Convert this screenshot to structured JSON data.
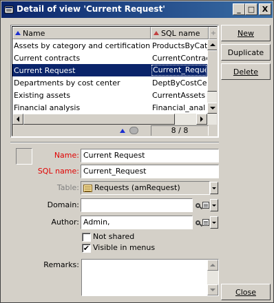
{
  "window": {
    "title": "Detail of view 'Current Request'"
  },
  "titlebar_buttons": {
    "minimize": "_",
    "maximize": "□",
    "close": "X"
  },
  "list": {
    "columns": {
      "name": "Name",
      "sql_name": "SQL name",
      "add": "+"
    },
    "rows": [
      {
        "name": "Assets by category and certification",
        "sql": "ProductsByCat"
      },
      {
        "name": "Current contracts",
        "sql": "CurrentContrac"
      },
      {
        "name": "Current Request",
        "sql": "Current_Reque",
        "selected": true
      },
      {
        "name": "Departments by cost center",
        "sql": "DeptByCostCe"
      },
      {
        "name": "Existing assets",
        "sql": "CurrentAssets"
      },
      {
        "name": "Financial analysis",
        "sql": "Financial_anal"
      }
    ],
    "counter": "8 / 8"
  },
  "buttons": {
    "new": "New",
    "duplicate": "Duplicate",
    "delete": "Delete",
    "close": "Close"
  },
  "form": {
    "name_label": "Name:",
    "name_value": "Current Request",
    "sql_label": "SQL name:",
    "sql_value": "Current_Request",
    "table_label": "Table:",
    "table_value": "Requests (amRequest)",
    "domain_label": "Domain:",
    "domain_value": "",
    "author_label": "Author:",
    "author_value": "Admin,",
    "not_shared_label": "Not shared",
    "not_shared_checked": false,
    "visible_label": "Visible in menus",
    "visible_checked": true,
    "remarks_label": "Remarks:",
    "remarks_value": ""
  },
  "colors": {
    "title_start": "#0a246a",
    "title_end": "#3a6ea5",
    "required_label": "#e00000",
    "selection": "#0a246a"
  }
}
